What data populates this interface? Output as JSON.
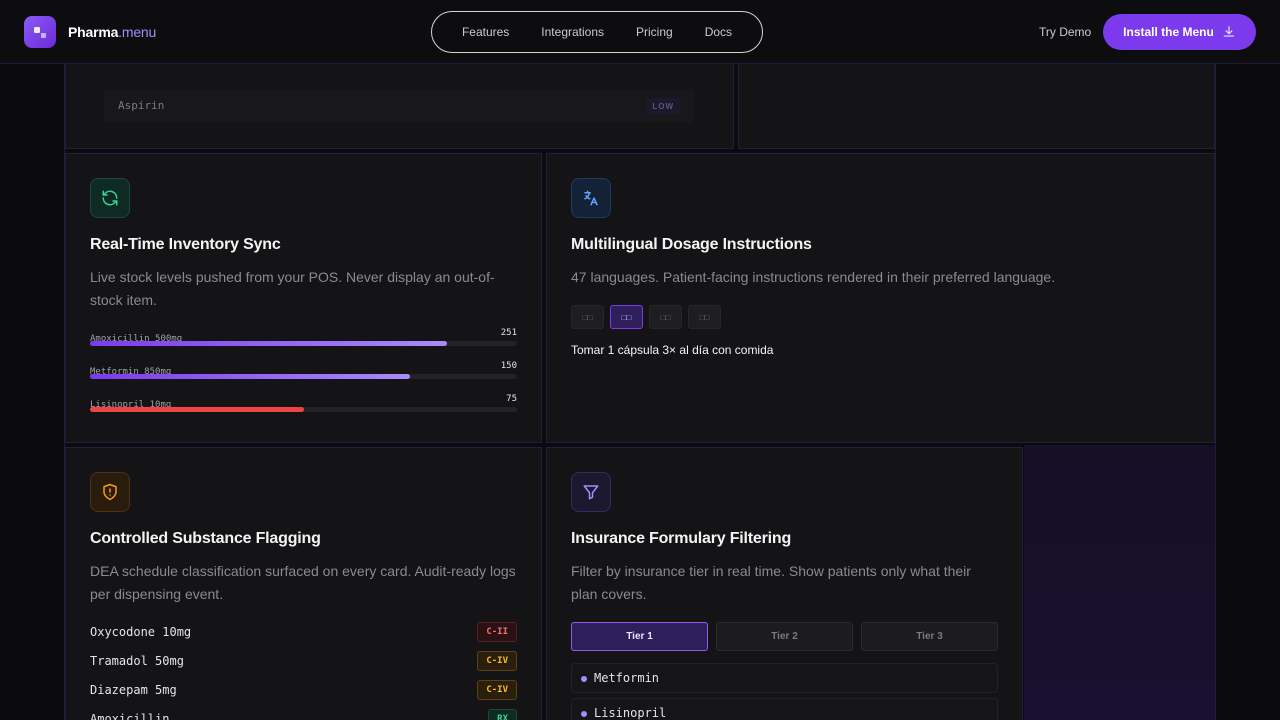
{
  "header": {
    "brand_main": "Pharma",
    "brand_suffix": ".menu",
    "nav": [
      "Features",
      "Integrations",
      "Pricing",
      "Docs"
    ],
    "try_demo": "Try Demo",
    "install_label": "Install the Menu"
  },
  "top_card": {
    "item_name": "Aspirin",
    "item_level": "LOW"
  },
  "inventory": {
    "title": "Real-Time Inventory Sync",
    "description": "Live stock levels pushed from your POS. Never display an out-of-stock item.",
    "items": [
      {
        "name": "Amoxicillin 500mg",
        "count": "251",
        "level": 0.836,
        "color": "#8b5cf6"
      },
      {
        "name": "Metformin 850mg",
        "count": "150",
        "level": 0.75,
        "color": "#8b5cf6"
      },
      {
        "name": "Lisinopril 10mg",
        "count": "75",
        "level": 0.5,
        "color": "#ef4444"
      }
    ]
  },
  "multilingual": {
    "title": "Multilingual Dosage Instructions",
    "description": "47 languages. Patient-facing instructions rendered in their preferred language.",
    "languages": [
      "□□",
      "□□",
      "□□",
      "□□"
    ],
    "active_index": 1,
    "instruction": "Tomar 1 cápsula 3× al día con comida"
  },
  "controlled": {
    "title": "Controlled Substance Flagging",
    "description": "DEA schedule classification surfaced on every card. Audit-ready logs per dispensing event.",
    "items": [
      {
        "name": "Oxycodone 10mg",
        "schedule": "C-II",
        "color": "#ef4444"
      },
      {
        "name": "Tramadol 50mg",
        "schedule": "C-IV",
        "color": "#f59e0b"
      },
      {
        "name": "Diazepam 5mg",
        "schedule": "C-IV",
        "color": "#f59e0b"
      },
      {
        "name": "Amoxicillin",
        "schedule": "RX",
        "color": "#10b981"
      }
    ]
  },
  "formulary": {
    "title": "Insurance Formulary Filtering",
    "description": "Filter by insurance tier in real time. Show patients only what their plan covers.",
    "tiers": [
      "Tier 1",
      "Tier 2",
      "Tier 3"
    ],
    "active_tier": 0,
    "items": [
      "Metformin",
      "Lisinopril"
    ]
  },
  "icons": {
    "logo": "logo-icon",
    "install": "download-icon",
    "inventory": "refresh-icon",
    "multilingual": "translate-icon",
    "controlled": "shield-alert-icon",
    "formulary": "filter-icon"
  },
  "colors": {
    "accent": "#7c3aed",
    "green": "#10b981",
    "amber": "#f59e0b",
    "red": "#ef4444",
    "blue": "#60a5fa"
  }
}
